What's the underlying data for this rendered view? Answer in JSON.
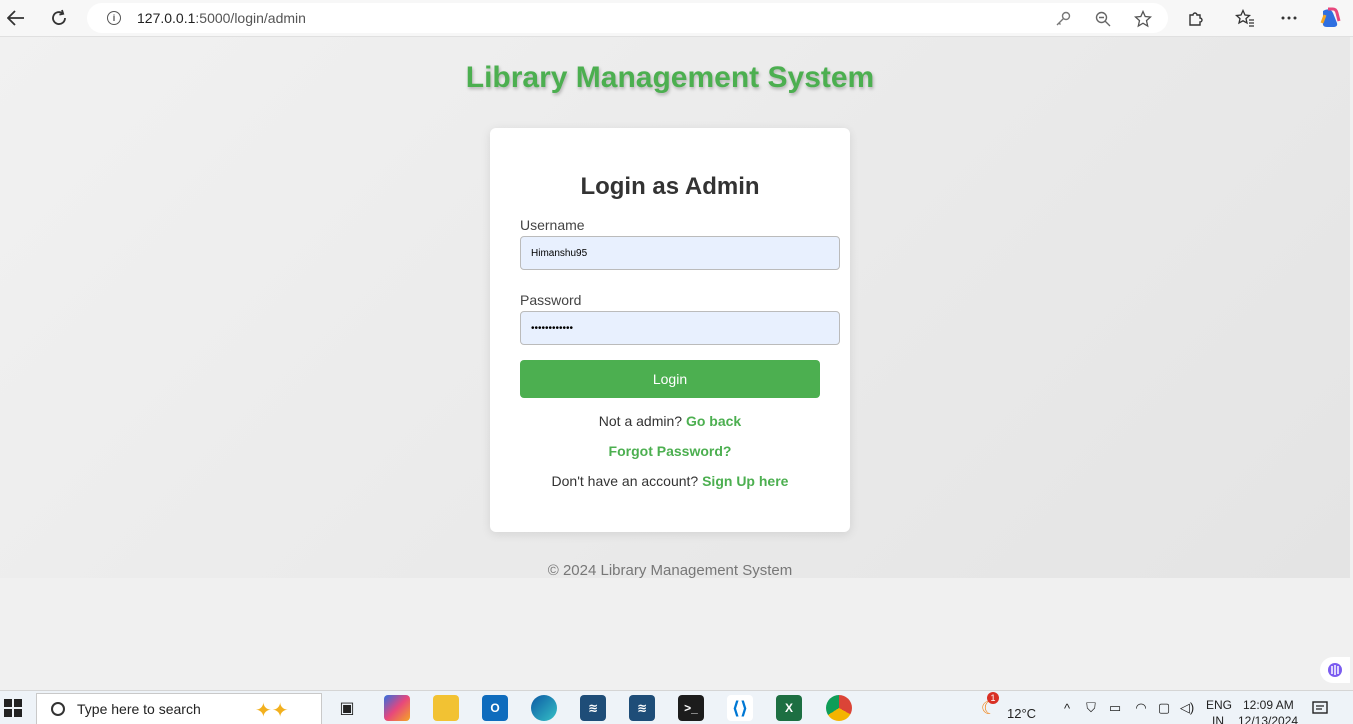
{
  "browser": {
    "url_host": "127.0.0.1",
    "url_path": ":5000/login/admin"
  },
  "page": {
    "site_title": "Library Management System",
    "card_title": "Login as Admin",
    "username_label": "Username",
    "username_value": "Himanshu95",
    "password_label": "Password",
    "password_value": "••••••••••••",
    "login_label": "Login",
    "not_admin_text": "Not a admin?",
    "go_back_link": "Go back",
    "forgot_link": "Forgot Password?",
    "no_account_text": "Don't have an account?",
    "signup_link": "Sign Up here",
    "footer": "© 2024 Library Management System"
  },
  "colors": {
    "accent": "#4caf50",
    "input_bg": "#e8f0fe"
  },
  "taskbar": {
    "search_placeholder": "Type here to search",
    "weather": "12°C",
    "weather_badge": "1",
    "language_1": "ENG",
    "language_2": "IN",
    "time": "12:09 AM",
    "date": "12/13/2024",
    "apps": [
      "task-view-icon",
      "copilot-icon",
      "file-explorer-icon",
      "outlook-icon",
      "edge-icon",
      "mysql-workbench-icon",
      "mysql-workbench-icon",
      "terminal-icon",
      "vscode-icon",
      "excel-icon",
      "chrome-icon"
    ]
  }
}
